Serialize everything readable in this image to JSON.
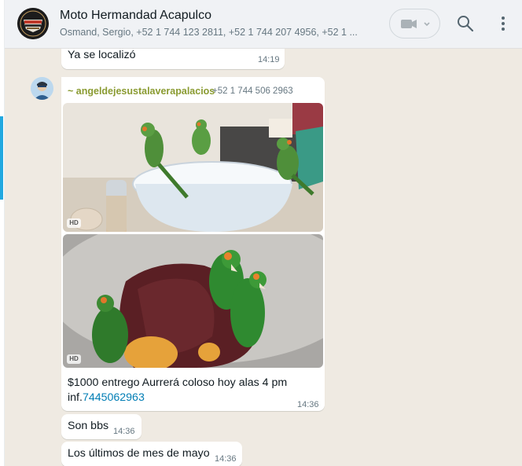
{
  "header": {
    "group_name": "Moto Hermandad Acapulco",
    "participants": "Osmand, Sergio, +52 1 744 123 2811, +52 1 744 207 4956, +52 1 ...",
    "avatar_lines": [
      "MOTO",
      "HARLEY-DAVIDSON",
      "CENTER"
    ]
  },
  "messages": [
    {
      "text": "Ya se localizó",
      "time": "14:19"
    },
    {
      "sender_name": "~ angeldejesustalaverapalacios",
      "sender_phone": "+52 1 744 506 2963",
      "photos": [
        {
          "badge": "HD"
        },
        {
          "badge": "HD"
        }
      ],
      "caption_line1": "$1000 entrego Aurrerá coloso hoy alas 4 pm",
      "caption_prefix": "inf.",
      "caption_link": "7445062963",
      "time": "14:36"
    },
    {
      "text": "Son bbs",
      "time": "14:36"
    },
    {
      "text": "Los últimos de mes de mayo",
      "time": "14:36"
    }
  ],
  "colors": {
    "chat_background": "#efeae2",
    "bubble": "#ffffff",
    "sender_name": "#8a9b31",
    "link": "#027eb5",
    "accent": "#21a8e0"
  },
  "icons": [
    "video-call-icon",
    "chevron-down-icon",
    "search-icon",
    "menu-icon"
  ]
}
